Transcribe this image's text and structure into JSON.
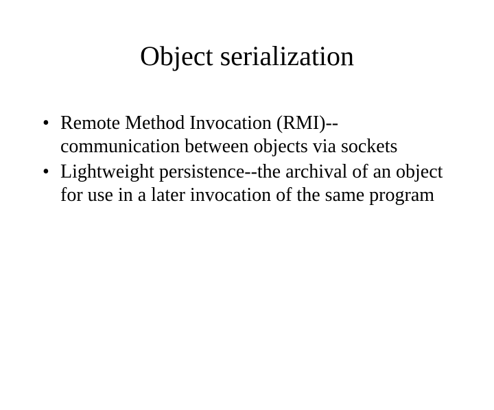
{
  "slide": {
    "title": "Object serialization",
    "bullets": [
      "Remote Method Invocation (RMI)--communication between objects via sockets",
      "Lightweight persistence--the archival of an object for use in a later invocation of the same program"
    ]
  }
}
